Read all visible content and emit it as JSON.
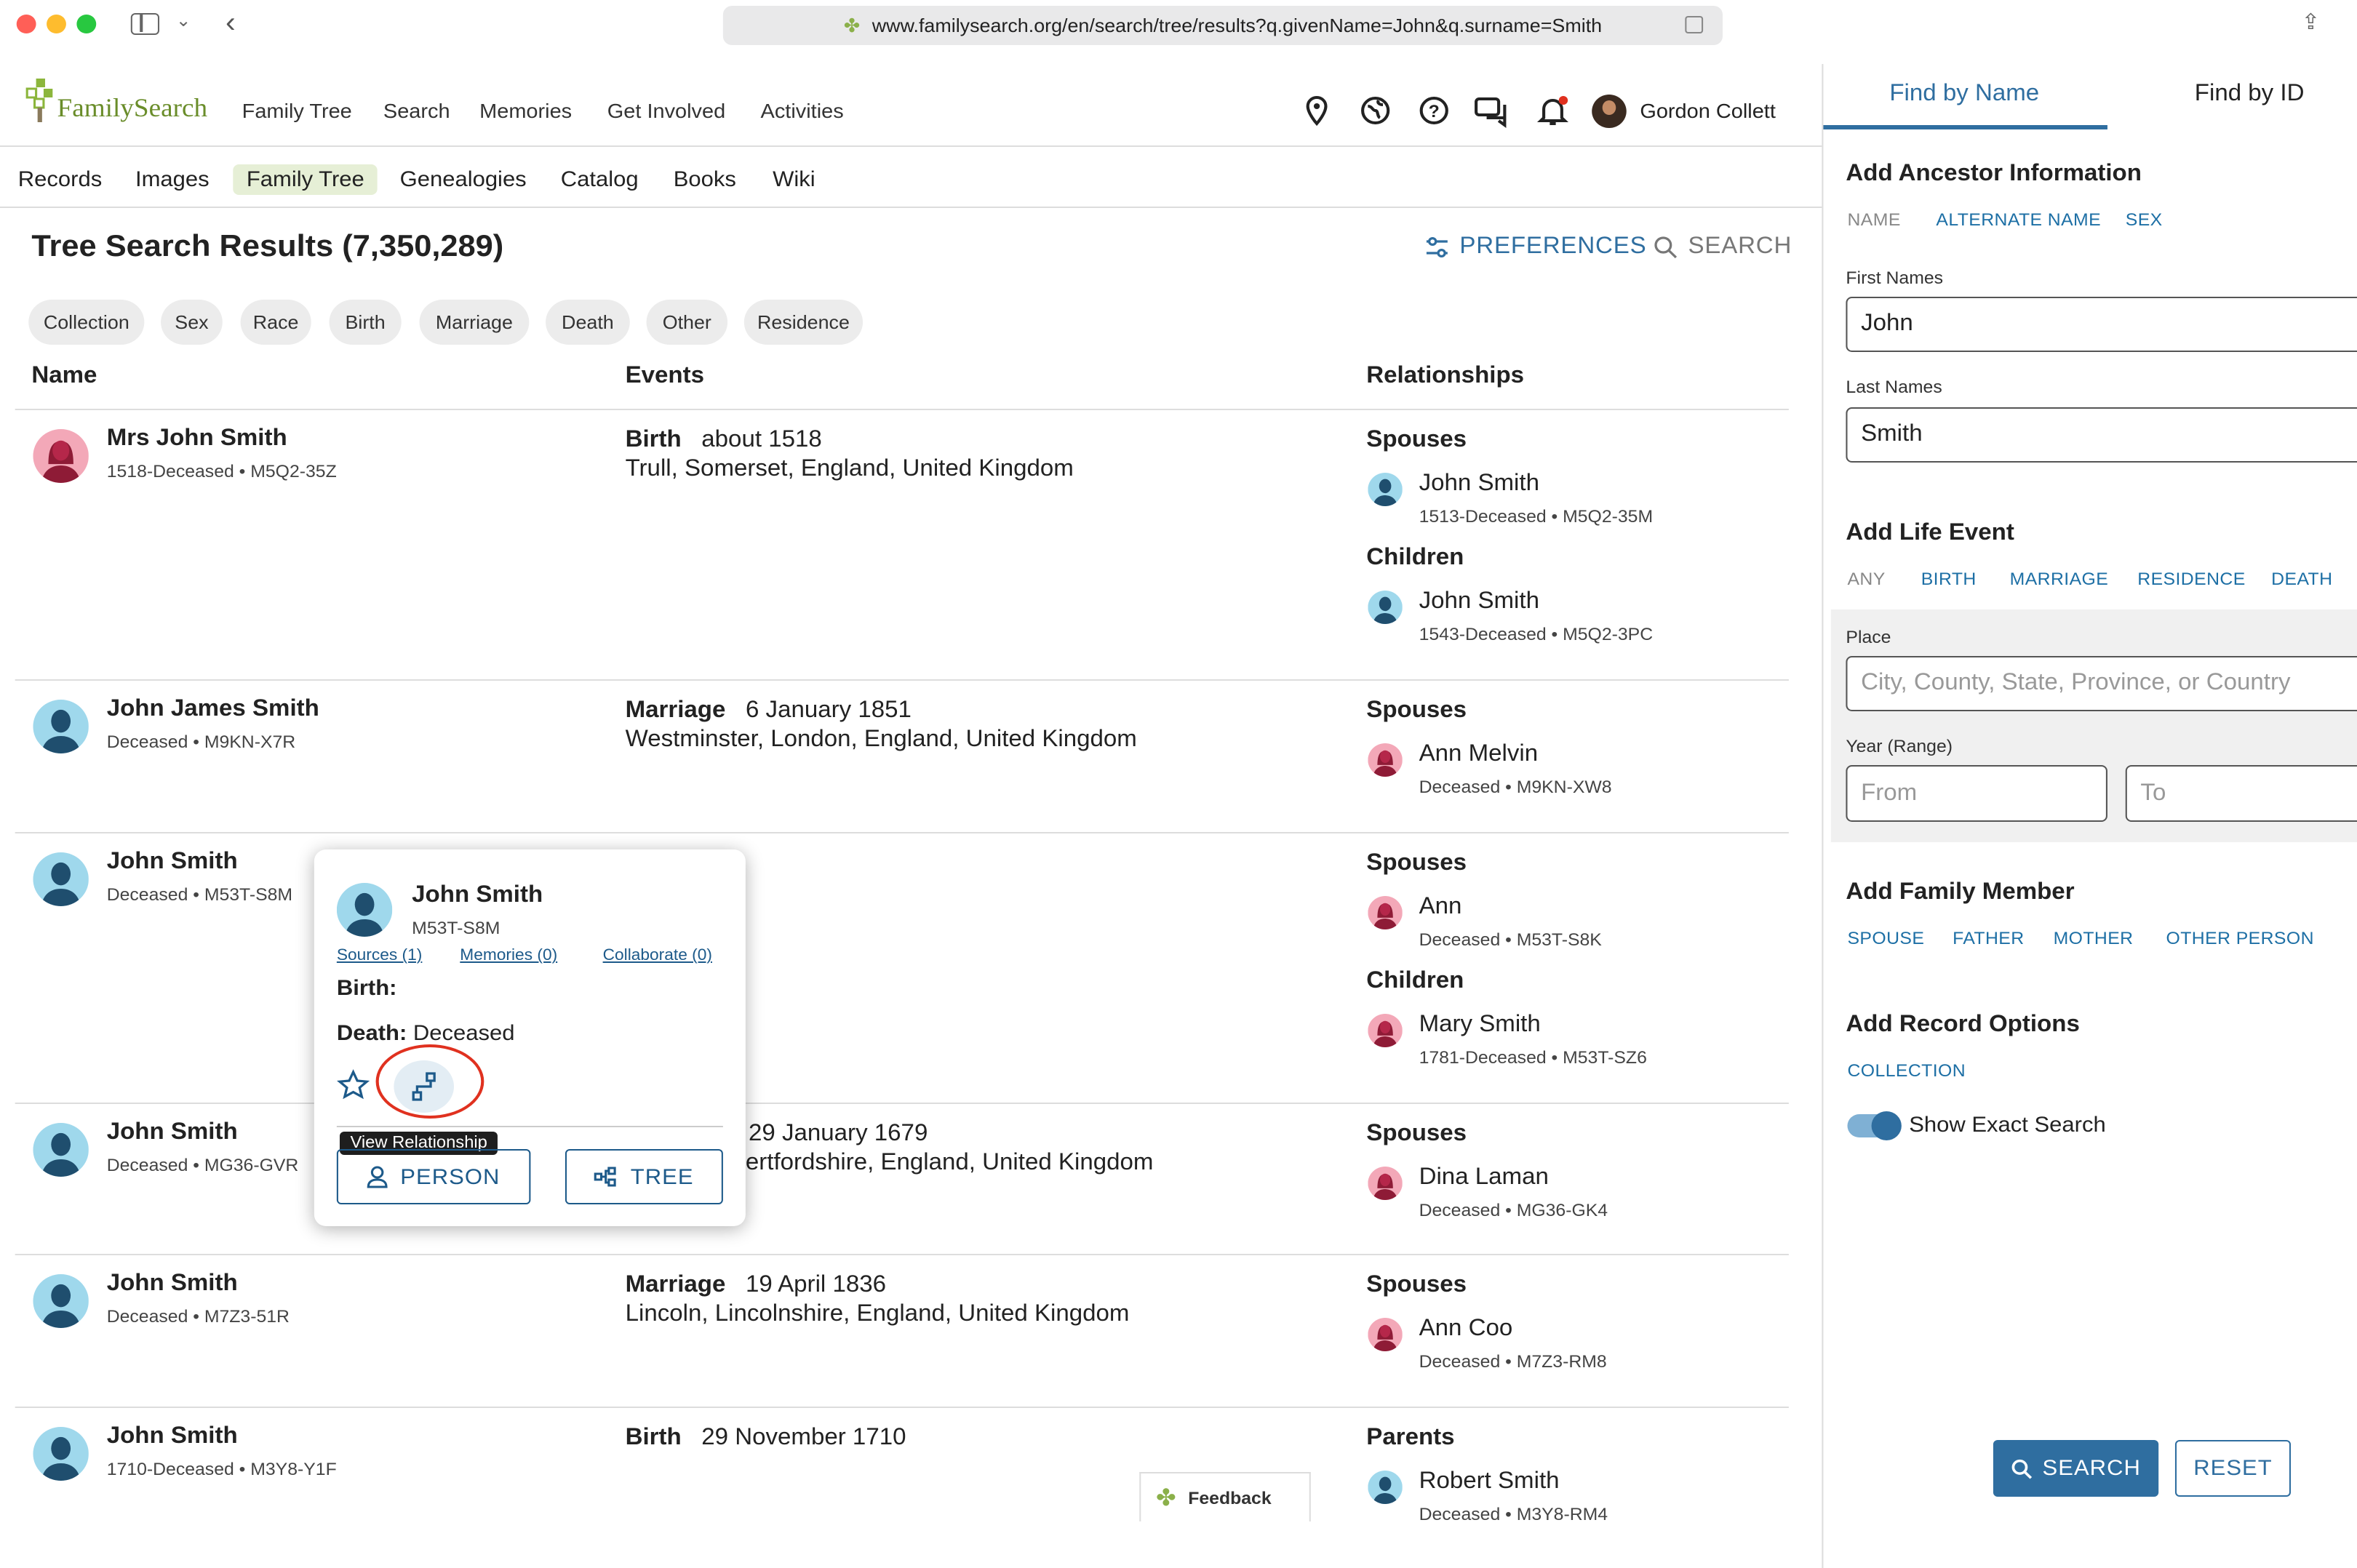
{
  "browser": {
    "url": "www.familysearch.org/en/search/tree/results?q.givenName=John&q.surname=Smith"
  },
  "header": {
    "logo": "FamilySearch",
    "nav": [
      "Family Tree",
      "Search",
      "Memories",
      "Get Involved",
      "Activities"
    ],
    "user": "Gordon Collett"
  },
  "subnav": [
    "Records",
    "Images",
    "Family Tree",
    "Genealogies",
    "Catalog",
    "Books",
    "Wiki"
  ],
  "results": {
    "title": "Tree Search Results (7,350,289)",
    "preferences": "PREFERENCES",
    "search": "SEARCH",
    "filters": [
      "Collection",
      "Sex",
      "Race",
      "Birth",
      "Marriage",
      "Death",
      "Other",
      "Residence"
    ],
    "columns": {
      "name": "Name",
      "events": "Events",
      "relationships": "Relationships"
    },
    "rows": [
      {
        "name": "Mrs John Smith",
        "meta": "1518-Deceased • M5Q2-35Z",
        "sex": "female",
        "event_type": "Birth",
        "event_date": "about 1518",
        "event_place": "Trull, Somerset, England, United Kingdom",
        "rel1_label": "Spouses",
        "rel1_name": "John Smith",
        "rel1_meta": "1513-Deceased • M5Q2-35M",
        "rel2_label": "Children",
        "rel2_name": "John Smith",
        "rel2_meta": "1543-Deceased • M5Q2-3PC"
      },
      {
        "name": "John James Smith",
        "meta": "Deceased • M9KN-X7R",
        "sex": "male",
        "event_type": "Marriage",
        "event_date": "6 January 1851",
        "event_place": "Westminster, London, England, United Kingdom",
        "rel1_label": "Spouses",
        "rel1_name": "Ann Melvin",
        "rel1_meta": "Deceased • M9KN-XW8"
      },
      {
        "name": "John Smith",
        "meta": "Deceased • M53T-S8M",
        "sex": "male",
        "rel1_label": "Spouses",
        "rel1_name": "Ann",
        "rel1_meta": "Deceased • M53T-S8K",
        "rel2_label": "Children",
        "rel2_name": "Mary Smith",
        "rel2_meta": "1781-Deceased • M53T-SZ6"
      },
      {
        "name": "John Smith",
        "meta": "Deceased • MG36-GVR",
        "sex": "male",
        "event_date": "29 January 1679",
        "event_place": "ertfordshire, England, United Kingdom",
        "rel1_label": "Spouses",
        "rel1_name": "Dina Laman",
        "rel1_meta": "Deceased • MG36-GK4"
      },
      {
        "name": "John Smith",
        "meta": "Deceased • M7Z3-51R",
        "sex": "male",
        "event_type": "Marriage",
        "event_date": "19 April 1836",
        "event_place": "Lincoln, Lincolnshire, England, United Kingdom",
        "rel1_label": "Spouses",
        "rel1_name": "Ann Coo",
        "rel1_meta": "Deceased • M7Z3-RM8"
      },
      {
        "name": "John Smith",
        "meta": "1710-Deceased • M3Y8-Y1F",
        "sex": "male",
        "event_type": "Birth",
        "event_date": "29 November 1710",
        "rel1_label": "Parents",
        "rel1_name": "Robert Smith",
        "rel1_meta": "Deceased • M3Y8-RM4"
      }
    ]
  },
  "popover": {
    "name": "John Smith",
    "pid": "M53T-S8M",
    "sources": "Sources (1)",
    "memories": "Memories (0)",
    "collaborate": "Collaborate (0)",
    "birth_label": "Birth:",
    "death_label": "Death:",
    "death_value": "Deceased",
    "tooltip": "View Relationship",
    "person_btn": "PERSON",
    "tree_btn": "TREE"
  },
  "feedback": "Feedback",
  "panel": {
    "tab_name": "Find by Name",
    "tab_id": "Find by ID",
    "ancestor_h": "Add Ancestor Information",
    "ancestor_links": [
      "NAME",
      "ALTERNATE NAME",
      "SEX"
    ],
    "first_label": "First Names",
    "first_value": "John",
    "last_label": "Last Names",
    "last_value": "Smith",
    "life_h": "Add Life Event",
    "life_links": [
      "ANY",
      "BIRTH",
      "MARRIAGE",
      "RESIDENCE",
      "DEATH"
    ],
    "place_label": "Place",
    "place_ph": "City, County, State, Province, or Country",
    "year_label": "Year (Range)",
    "from_ph": "From",
    "to_ph": "To",
    "family_h": "Add Family Member",
    "family_links": [
      "SPOUSE",
      "FATHER",
      "MOTHER",
      "OTHER PERSON"
    ],
    "record_h": "Add Record Options",
    "record_link": "COLLECTION",
    "exact_label": "Show Exact Search",
    "search_btn": "SEARCH",
    "reset_btn": "RESET"
  },
  "colors": {
    "accent": "#2f6ea0",
    "male": "#9fd8ec",
    "female": "#f3a8b8",
    "tooltip": "#222222"
  }
}
